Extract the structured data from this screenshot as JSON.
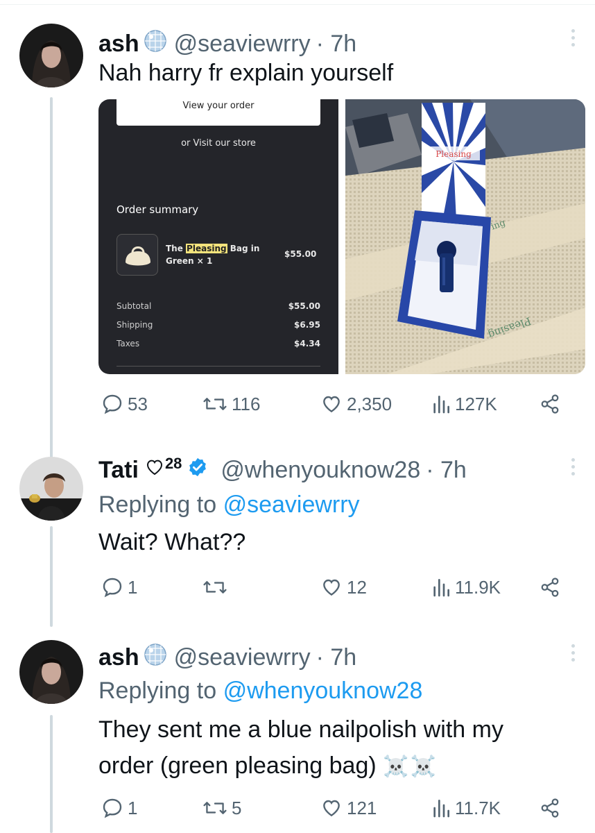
{
  "tweets": [
    {
      "name": "ash",
      "handle": "@seaviewrry",
      "time": "· 7h",
      "text": "Nah harry fr explain yourself",
      "actions": {
        "replies": "53",
        "retweets": "116",
        "likes": "2,350",
        "views": "127K"
      }
    },
    {
      "name": "Tati",
      "name_suffix": "28",
      "handle": "@whenyouknow28",
      "time": "· 7h",
      "replying_label": "Replying to",
      "replying_to": "@seaviewrry",
      "text": "Wait? What??",
      "actions": {
        "replies": "1",
        "retweets": "",
        "likes": "12",
        "views": "11.9K"
      }
    },
    {
      "name": "ash",
      "handle": "@seaviewrry",
      "time": "· 7h",
      "replying_label": "Replying to",
      "replying_to": "@whenyouknow28",
      "text_line1": "They sent me a blue nailpolish with my",
      "text_line2": "order (green pleasing bag)",
      "emoji": "☠️☠️",
      "actions": {
        "replies": "1",
        "retweets": "5",
        "likes": "121",
        "views": "11.7K"
      }
    }
  ],
  "receipt": {
    "view_order": "View your order",
    "visit_store": "or Visit our store",
    "summary_title": "Order summary",
    "item_prefix": "The ",
    "item_highlight": "Pleasing",
    "item_rest": " Bag in Green × 1",
    "item_price": "$55.00",
    "rows": [
      {
        "label": "Subtotal",
        "value": "$55.00"
      },
      {
        "label": "Shipping",
        "value": "$6.95"
      },
      {
        "label": "Taxes",
        "value": "$4.34"
      }
    ]
  },
  "photo": {
    "box_label": "Pleasing",
    "bag_text_1": "ing",
    "bag_text_2": "Pleasing"
  },
  "colors": {
    "accent": "#1d9bf0",
    "secondary_text": "#536471",
    "thread_line": "#cfd9de",
    "highlight": "#f3e37c"
  },
  "icons": [
    "disco-ball-badge-icon",
    "verified-badge-icon",
    "heart-outline-icon",
    "reply-icon",
    "retweet-icon",
    "like-icon",
    "views-icon",
    "share-icon",
    "more-icon",
    "skull-crossbones-icon"
  ]
}
